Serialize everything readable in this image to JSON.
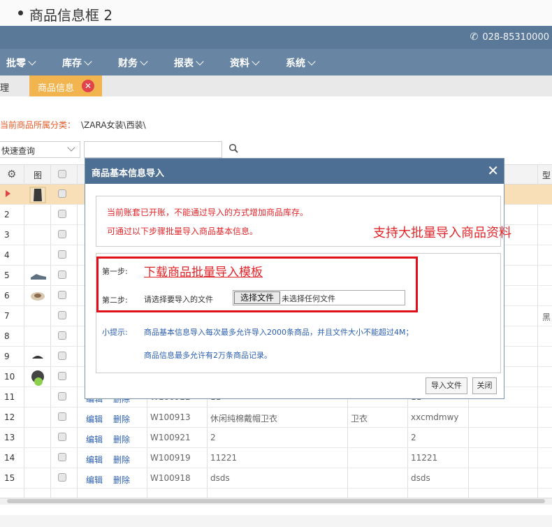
{
  "slide": {
    "title": "商品信息框 2"
  },
  "topbar": {
    "phone": "028-85310000"
  },
  "menu": [
    "批零",
    "库存",
    "财务",
    "报表",
    "资料",
    "系统"
  ],
  "tabs": {
    "prev_partial": "理",
    "active": "商品信息"
  },
  "category": {
    "label": "当前商品所属分类：",
    "value": "\\ZARA女装\\西装\\"
  },
  "query": {
    "select_value": "快速查询",
    "input_value": ""
  },
  "grid": {
    "header": {
      "image_col": "图",
      "type_col": "型"
    },
    "rows": [
      {
        "num": "",
        "edit": "",
        "del": "",
        "code": "",
        "name": "",
        "cat": "",
        "spec": "",
        "color": ""
      },
      {
        "num": "2",
        "edit": "",
        "del": "",
        "code": "",
        "name": "",
        "cat": "",
        "spec": "",
        "color": ""
      },
      {
        "num": "3",
        "edit": "",
        "del": "",
        "code": "",
        "name": "",
        "cat": "",
        "spec": "",
        "color": ""
      },
      {
        "num": "4",
        "edit": "",
        "del": "",
        "code": "",
        "name": "",
        "cat": "",
        "spec": "",
        "color": ""
      },
      {
        "num": "5",
        "edit": "",
        "del": "",
        "code": "",
        "name": "",
        "cat": "",
        "spec": "",
        "color": ""
      },
      {
        "num": "6",
        "edit": "",
        "del": "",
        "code": "",
        "name": "",
        "cat": "",
        "spec": "",
        "color": ""
      },
      {
        "num": "7",
        "edit": "",
        "del": "",
        "code": "",
        "name": "",
        "cat": "",
        "spec": "",
        "color": "黑"
      },
      {
        "num": "8",
        "edit": "",
        "del": "",
        "code": "",
        "name": "",
        "cat": "",
        "spec": "",
        "color": ""
      },
      {
        "num": "9",
        "edit": "",
        "del": "",
        "code": "",
        "name": "",
        "cat": "",
        "spec": "",
        "color": ""
      },
      {
        "num": "10",
        "edit": "",
        "del": "",
        "code": "",
        "name": "",
        "cat": "",
        "spec": "",
        "color": ""
      },
      {
        "num": "11",
        "edit": "编辑",
        "del": "删除",
        "code": "W100922",
        "name": "11",
        "cat": "",
        "spec": "11",
        "color": ""
      },
      {
        "num": "12",
        "edit": "编辑",
        "del": "删除",
        "code": "W100913",
        "name": "休闲纯棉戴帽卫衣",
        "cat": "卫衣",
        "spec": "xxcmdmwy",
        "color": ""
      },
      {
        "num": "13",
        "edit": "编辑",
        "del": "删除",
        "code": "W100921",
        "name": "2",
        "cat": "",
        "spec": "2",
        "color": ""
      },
      {
        "num": "14",
        "edit": "编辑",
        "del": "删除",
        "code": "W100919",
        "name": "11221",
        "cat": "",
        "spec": "11221",
        "color": ""
      },
      {
        "num": "15",
        "edit": "编辑",
        "del": "删除",
        "code": "W100918",
        "name": "dsds",
        "cat": "",
        "spec": "dsds",
        "color": ""
      }
    ]
  },
  "dialog": {
    "title": "商品基本信息导入",
    "notice_line1": "当前账套已开账，不能通过导入的方式增加商品库存。",
    "notice_line2": "可通过以下步骤批量导入商品基本信息。",
    "step1_label": "第一步:",
    "step1_link": "下载商品批量导入模板",
    "step2_label": "第二步:",
    "step2_text": "请选择要导入的文件",
    "file_button": "选择文件",
    "file_status": "未选择任何文件",
    "tip_label": "小提示:",
    "tip1": "商品基本信息导入每次最多允许导入2000条商品，并且文件大小不能超过4M；",
    "tip2": "商品信息最多允许有2万条商品记录。",
    "import_button": "导入文件",
    "close_button": "关闭"
  },
  "annotation": {
    "promo": "支持大批量导入商品资料"
  },
  "colors": {
    "topbar": "#5a7897",
    "menubar": "#6886a4",
    "tab_active": "#f1b44f",
    "dialog_header": "#4e6f94",
    "alert_red": "#e0262a",
    "link_blue": "#2a5eb0"
  }
}
